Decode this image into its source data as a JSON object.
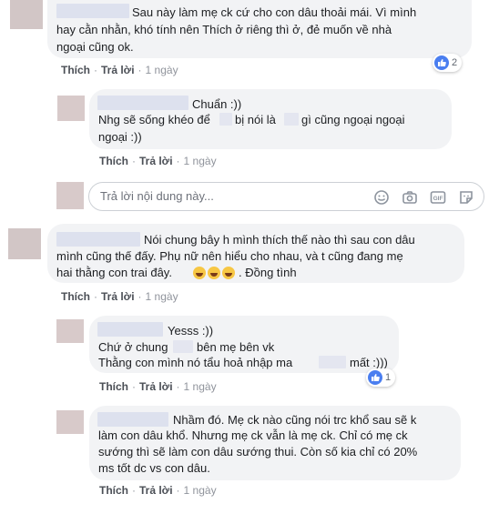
{
  "actions": {
    "like": "Thích",
    "reply": "Trả lời",
    "sep": "·"
  },
  "comments": [
    {
      "lines": [
        "Sau này làm mẹ ck cứ cho con dâu thoải mái. Vì mình",
        "hay cằn nhằn, khó tính nên Thích ở riêng thì ở, đẻ muốn về nhà",
        "ngoại cũng ok."
      ],
      "time": "1 ngày",
      "reactions": "2"
    },
    {
      "lines": [
        "Chuẩn :))",
        "Nhg sẽ sống khéo để",
        "bị nói là",
        "gì cũng ngoại ngoại",
        "ngoại :))"
      ],
      "time": "1 ngày"
    },
    {
      "lines": [
        "Nói chung bây h mình thích thế nào thì sau con dâu",
        "mình cũng thế đấy. Phụ nữ nên hiểu cho nhau, và t cũng đang mẹ",
        "hai thằng con trai đây.",
        ". Đồng tình"
      ],
      "time": "1 ngày"
    },
    {
      "lines": [
        "Yesss :))",
        "Chứ ở chung",
        "bên mẹ bên vk",
        "Thằng con mình nó tẩu hoả nhập ma",
        "mất :)))"
      ],
      "time": "1 ngày",
      "reactions": "1"
    },
    {
      "lines": [
        "Nhầm đó. Mẹ ck nào cũng nói trc khổ sau sẽ k",
        "làm con dâu khổ. Nhưng mẹ ck vẫn là mẹ ck. Chỉ có mẹ ck",
        "sướng thì sẽ làm con dâu sướng thui. Còn số kia chỉ có 20%",
        "ms tốt dc vs con dâu."
      ],
      "time": "1 ngày"
    }
  ],
  "reply_box": {
    "placeholder": "Trả lời nội dung này..."
  },
  "colors": {
    "like_blue": "#4a7ef0",
    "bubble_bg": "#f2f3f5",
    "link": "#4b4f56"
  }
}
